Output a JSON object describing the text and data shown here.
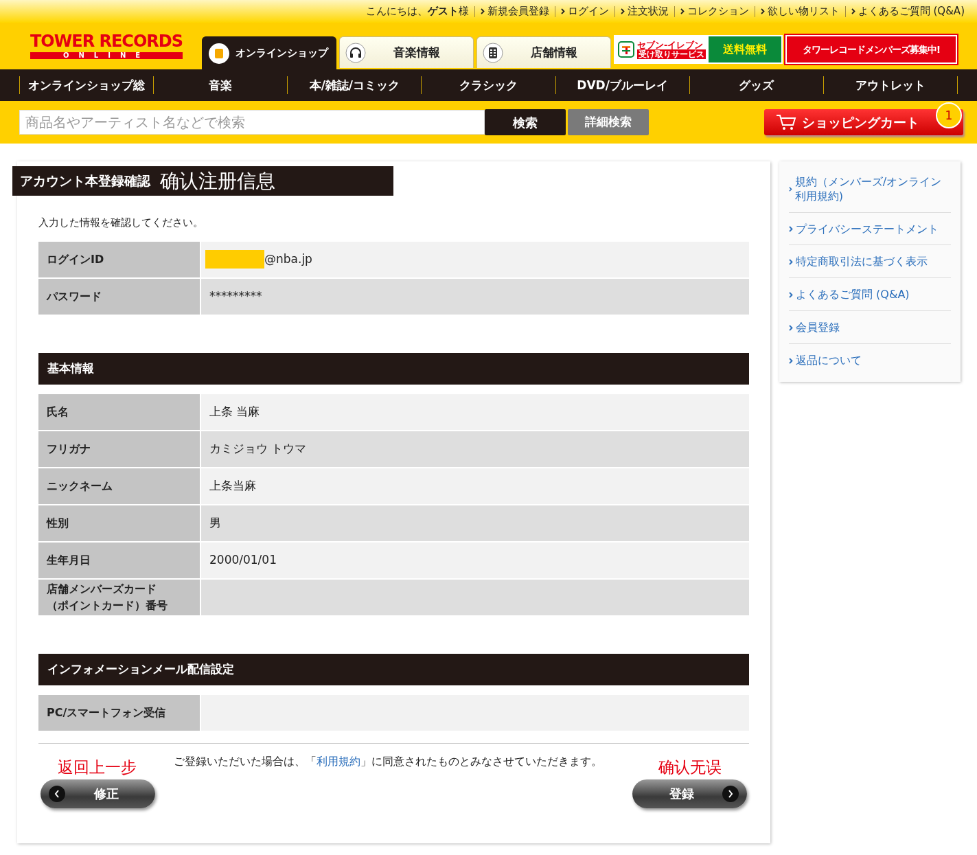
{
  "top_bar": {
    "greeting": "こんにちは、**ゲスト**様",
    "links": [
      "新規会員登録",
      "ログイン",
      "注文状況",
      "コレクション",
      "欲しい物リスト",
      "よくあるご質問 (Q&A)"
    ]
  },
  "logo": {
    "name": "TOWER RECORDS",
    "sub": "ONLINE"
  },
  "site_tabs": [
    {
      "label": "オンラインショップ",
      "selected": true
    },
    {
      "label": "音楽情報",
      "selected": false
    },
    {
      "label": "店舗情報",
      "selected": false
    }
  ],
  "banners": [
    {
      "kind": "seven",
      "title": "セブン-イレブン",
      "sub": "受け取りサービス",
      "badge": "送料無料"
    },
    {
      "kind": "members",
      "title": "タワーレコードメンバーズ募集中!"
    }
  ],
  "category_nav": [
    "オンラインショップ総",
    "音楽",
    "本/雑誌/コミック",
    "クラシック",
    "DVD/ブルーレイ",
    "グッズ",
    "アウトレット"
  ],
  "search": {
    "placeholder": "商品名やアーティスト名などで検索",
    "button": "検索",
    "advanced": "詳細検索"
  },
  "cart": {
    "label": "ショッピングカート",
    "count": "1"
  },
  "page": {
    "title": "アカウント本登録確認",
    "annotation": "确认注册信息",
    "intro": "入力した情報を確認してください。"
  },
  "sections": [
    {
      "rows": [
        {
          "label": "ログインID",
          "value": "@nba.jp",
          "redacted": true
        },
        {
          "label": "パスワード",
          "value": "*********"
        }
      ]
    },
    {
      "heading": "基本情報",
      "rows": [
        {
          "label": "氏名",
          "value": "上条 当麻"
        },
        {
          "label": "フリガナ",
          "value": "カミジョウ トウマ"
        },
        {
          "label": "ニックネーム",
          "value": "上条当麻"
        },
        {
          "label": "性別",
          "value": "男"
        },
        {
          "label": "生年月日",
          "value": "2000/01/01"
        },
        {
          "label": "店舗メンバーズカード（ポイントカード）番号"
        }
      ]
    },
    {
      "heading": "インフォメーションメール配信設定",
      "rows": [
        {
          "label": "PC/スマートフォン受信"
        }
      ]
    }
  ],
  "notice": {
    "before": "ご登録いただいた場合は、「",
    "link": "利用規約",
    "after": "」に同意されたものとみなさせていただきます。"
  },
  "actions": [
    {
      "kind": "back",
      "label": "修正",
      "annotation": "返回上一步"
    },
    {
      "kind": "next",
      "label": "登録",
      "annotation": "确认无误"
    }
  ],
  "sidebar": [
    "規約（メンバーズ/オンライン利用規約)",
    "プライバシーステートメント",
    "特定商取引法に基づく表示",
    "よくあるご質問 (Q&A)",
    "会員登録",
    "返品について"
  ]
}
